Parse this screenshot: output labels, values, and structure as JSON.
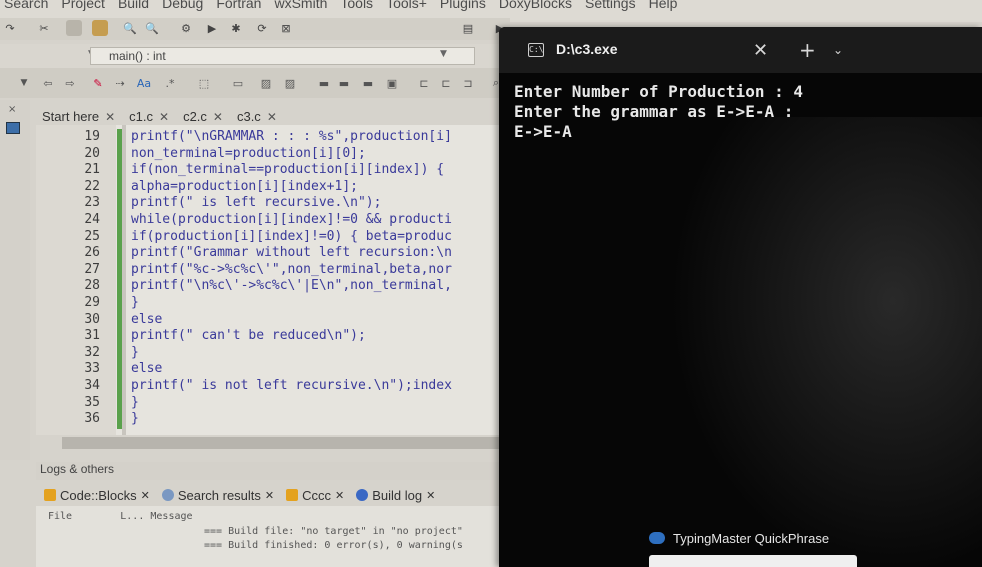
{
  "ide": {
    "menu": [
      "Search",
      "Project",
      "Build",
      "Debug",
      "Fortran",
      "wxSmith",
      "Tools",
      "Tools+",
      "Plugins",
      "DoxyBlocks",
      "Settings",
      "Help"
    ],
    "scope_value": "main() : int",
    "tabs": [
      {
        "label": "Start here"
      },
      {
        "label": "c1.c"
      },
      {
        "label": "c2.c"
      },
      {
        "label": "c3.c"
      }
    ],
    "code_lines": [
      {
        "ln": "19",
        "text": "printf(\"\\nGRAMMAR : : : %s\",production[i]"
      },
      {
        "ln": "20",
        "text": "non_terminal=production[i][0];"
      },
      {
        "ln": "21",
        "text": "if(non_terminal==production[i][index]) {"
      },
      {
        "ln": "22",
        "text": "alpha=production[i][index+1];"
      },
      {
        "ln": "23",
        "text": "printf(\" is left recursive.\\n\");"
      },
      {
        "ln": "24",
        "text": "while(production[i][index]!=0 && producti"
      },
      {
        "ln": "25",
        "text": "if(production[i][index]!=0) { beta=produc"
      },
      {
        "ln": "26",
        "text": "printf(\"Grammar without left recursion:\\n"
      },
      {
        "ln": "27",
        "text": "printf(\"%c->%c%c\\'\",non_terminal,beta,nor"
      },
      {
        "ln": "28",
        "text": "printf(\"\\n%c\\'->%c%c\\'|E\\n\",non_terminal,"
      },
      {
        "ln": "29",
        "text": "}"
      },
      {
        "ln": "30",
        "text": "else"
      },
      {
        "ln": "31",
        "text": "printf(\" can't be reduced\\n\");"
      },
      {
        "ln": "32",
        "text": "}"
      },
      {
        "ln": "33",
        "text": "else"
      },
      {
        "ln": "34",
        "text": "printf(\" is not left recursive.\\n\");index"
      },
      {
        "ln": "35",
        "text": "}"
      },
      {
        "ln": "36",
        "text": "}"
      }
    ],
    "logs": {
      "title": "Logs & others",
      "tabs": [
        {
          "label": "Code::Blocks",
          "icon": "codeblocks-icon"
        },
        {
          "label": "Search results",
          "icon": "search-icon"
        },
        {
          "label": "Cccc",
          "icon": "cccc-icon"
        },
        {
          "label": "Build log",
          "icon": "gear-icon"
        }
      ],
      "columns": [
        "File",
        "L...",
        "Message"
      ],
      "rows": [
        "=== Build file: \"no target\" in \"no project\"",
        "=== Build finished: 0 error(s), 0 warning(s"
      ]
    }
  },
  "terminal": {
    "title": "D:\\c3.exe",
    "lines": [
      "Enter Number of Production : 4",
      "Enter the grammar as E->E-A :",
      "E->E-A"
    ]
  },
  "toast": {
    "label": "TypingMaster QuickPhrase"
  }
}
